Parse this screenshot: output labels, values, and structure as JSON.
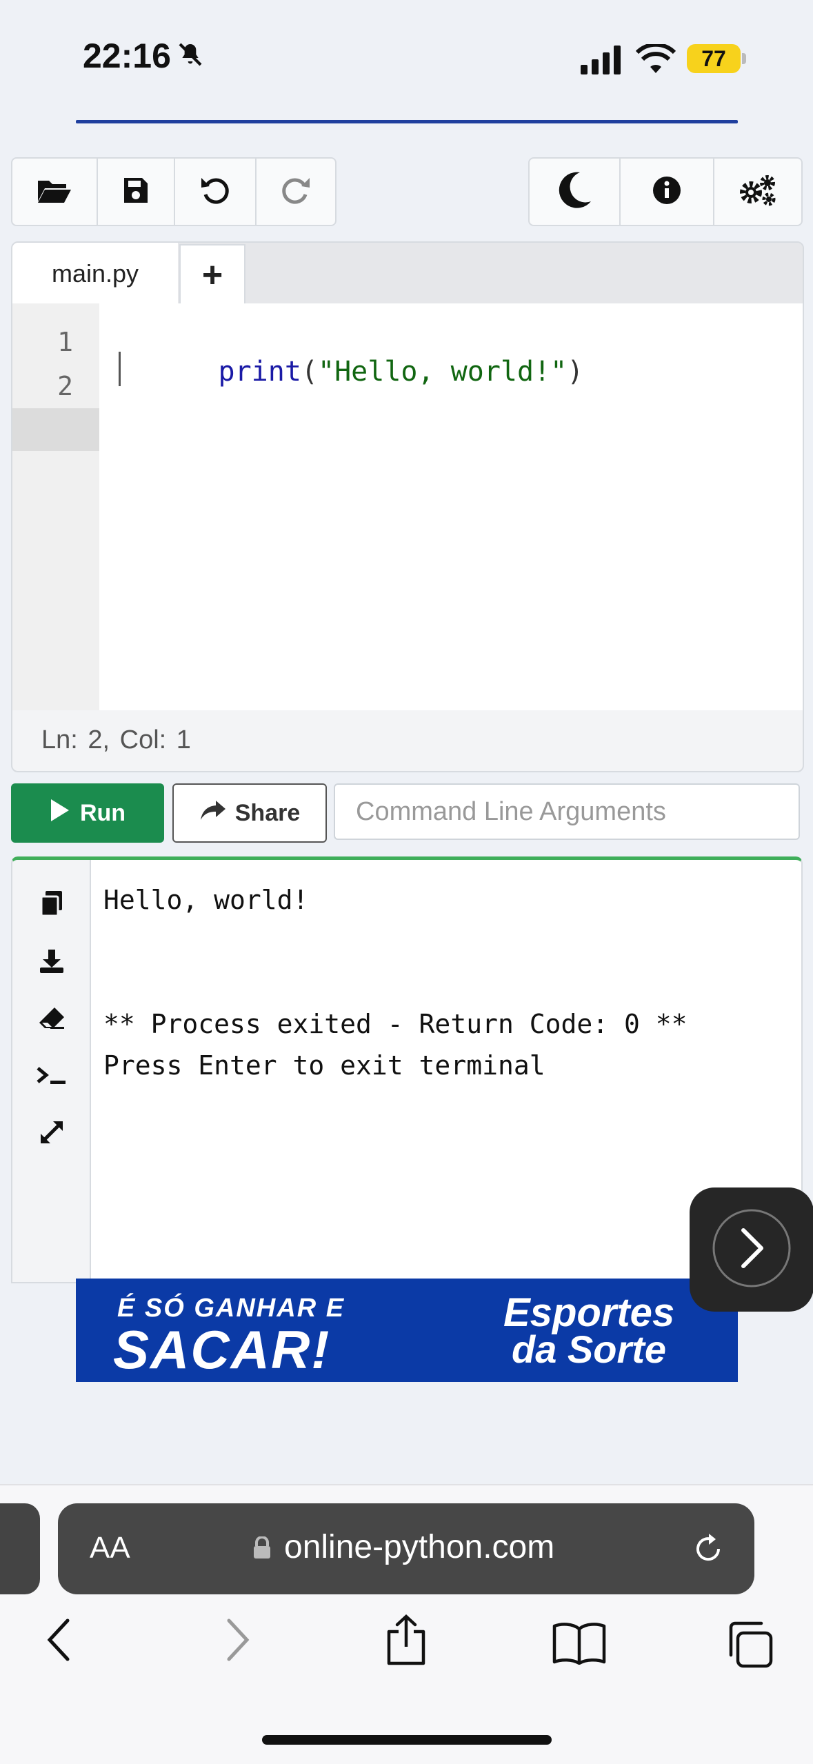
{
  "status_bar": {
    "time": "22:16",
    "battery": "77"
  },
  "toolbar": {
    "left_icons": [
      "folder-open-icon",
      "save-icon",
      "undo-icon",
      "redo-icon"
    ],
    "right_icons": [
      "moon-icon",
      "info-icon",
      "settings-icon"
    ]
  },
  "editor": {
    "tab_name": "main.py",
    "add_tab_label": "+",
    "line_numbers": [
      "1",
      "2"
    ],
    "code": {
      "fn": "print",
      "open": "(",
      "string": "\"Hello, world!\"",
      "close": ")"
    },
    "status": "Ln: 2,  Col: 1"
  },
  "actions": {
    "run_label": "Run",
    "share_label": "Share",
    "args_placeholder": "Command Line Arguments"
  },
  "terminal": {
    "lines": [
      "Hello, world!",
      "",
      "",
      "** Process exited - Return Code: 0 **",
      "Press Enter to exit terminal"
    ],
    "side_icons": [
      "copy-icon",
      "download-icon",
      "eraser-icon",
      "terminal-icon",
      "expand-icon"
    ]
  },
  "ad": {
    "line1": "É SÓ GANHAR E",
    "line2": "SACAR!",
    "brand_line1": "Esportes",
    "brand_line2": "da Sorte"
  },
  "browser": {
    "aa_label": "AA",
    "url": "online-python.com"
  },
  "colors": {
    "run_green": "#1b8c4e",
    "keyword_blue": "#1a1aa6",
    "string_green": "#116611",
    "ad_blue": "#0b3aa6",
    "battery_yellow": "#f7d21c"
  }
}
